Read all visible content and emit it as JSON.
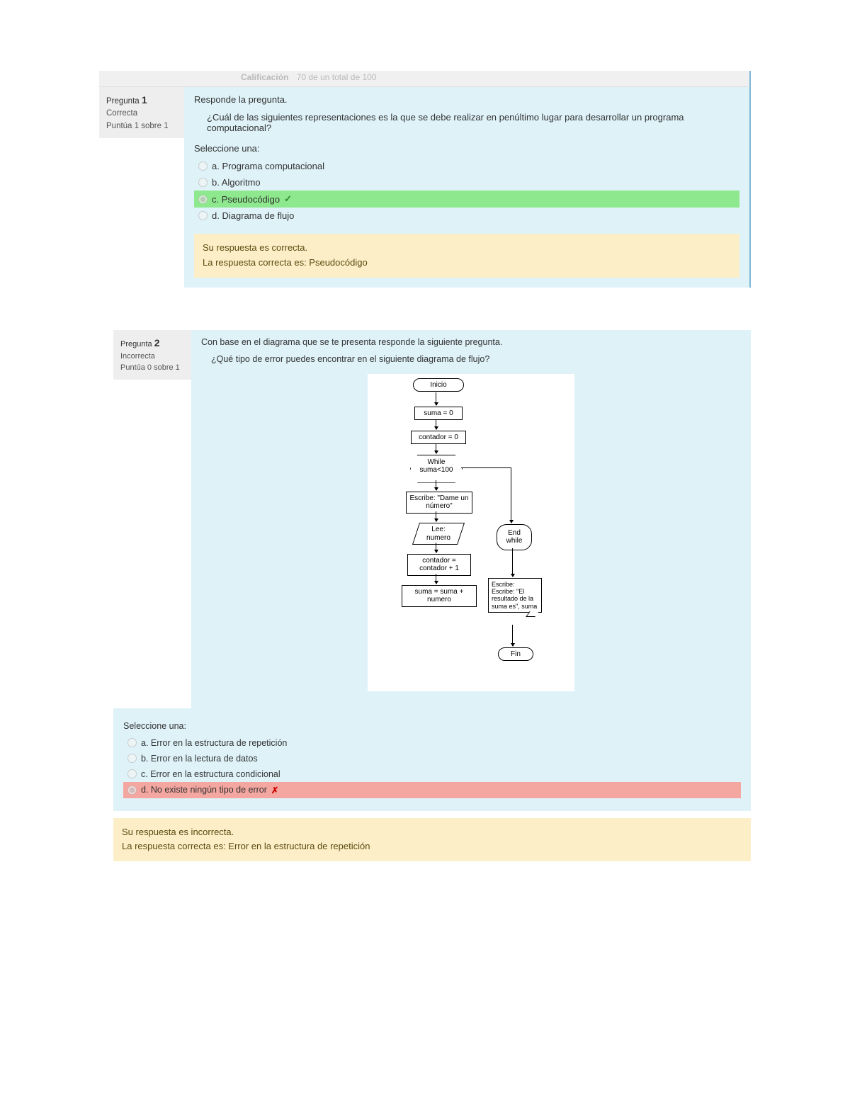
{
  "header": {
    "grade_label": "Calificación",
    "grade_value": "70 de un total de 100"
  },
  "q1": {
    "label": "Pregunta",
    "num": "1",
    "state": "Correcta",
    "score": "Puntúa 1 sobre 1",
    "prompt": "Responde la pregunta.",
    "sub": "¿Cuál de las siguientes representaciones es la que se debe realizar en penúltimo lugar para desarrollar un programa computacional?",
    "select": "Seleccione una:",
    "opts": {
      "a": "a. Programa computacional",
      "b": "b. Algoritmo",
      "c": "c. Pseudocódigo",
      "d": "d. Diagrama de flujo"
    },
    "fb1": "Su respuesta es correcta.",
    "fb2": "La respuesta correcta es: Pseudocódigo"
  },
  "q2": {
    "label": "Pregunta",
    "num": "2",
    "state": "Incorrecta",
    "score": "Puntúa 0 sobre 1",
    "prompt": "Con base en el diagrama que se te presenta responde la siguiente pregunta.",
    "sub": "¿Qué tipo de error puedes encontrar en el siguiente diagrama de flujo?",
    "select": "Seleccione una:",
    "opts": {
      "a": "a. Error en la estructura de repetición",
      "b": "b. Error en la lectura de datos",
      "c": "c. Error en la estructura condicional",
      "d": "d. No existe ningún tipo de error"
    },
    "fb1": "Su respuesta es incorrecta.",
    "fb2": "La respuesta correcta es: Error en la estructura de repetición"
  },
  "flow": {
    "start": "Inicio",
    "s1": "suma = 0",
    "s2": "contador = 0",
    "loop": "While suma<100",
    "w1": "Escribe: \"Dame un número\"",
    "r1": "Lee: numero",
    "s3": "contador = contador + 1",
    "s4": "suma = suma + numero",
    "endw": "End while",
    "out": "Escribe: Escribe: \"El resultado de la suma es\", suma",
    "end": "Fin"
  }
}
